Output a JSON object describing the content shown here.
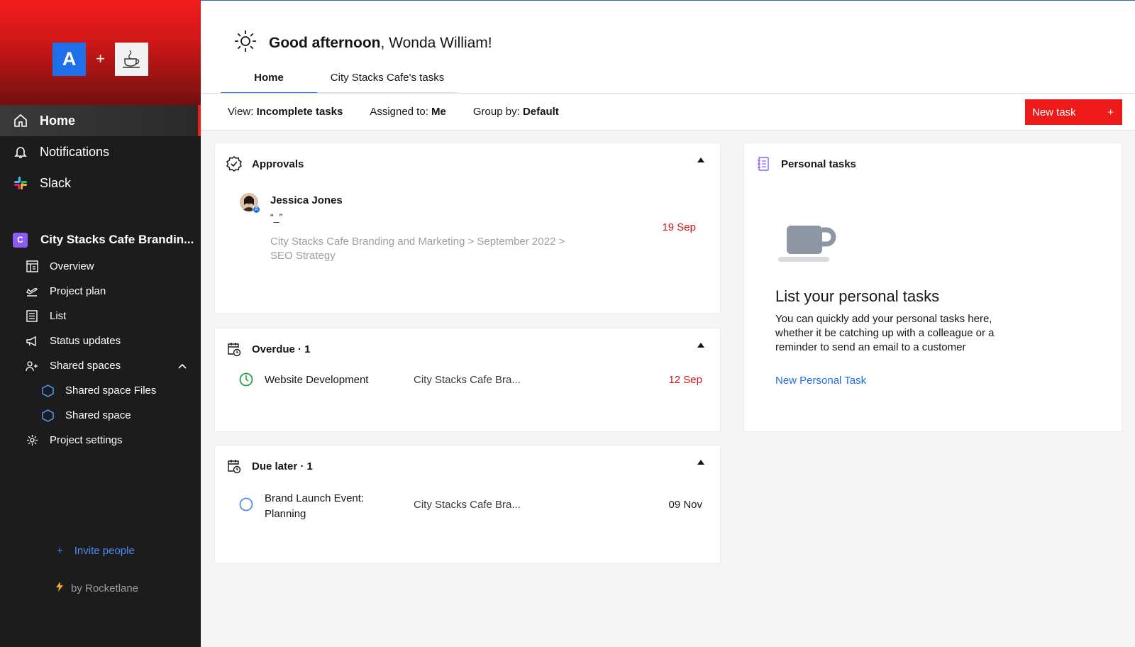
{
  "sidebar": {
    "brand_plus": "+",
    "brand_logo_letter": "A",
    "nav": [
      {
        "label": "Home",
        "icon": "home-icon"
      },
      {
        "label": "Notifications",
        "icon": "bell-icon"
      },
      {
        "label": "Slack",
        "icon": "slack-icon"
      }
    ],
    "project": {
      "badge": "C",
      "title": "City Stacks Cafe Brandin...",
      "items": [
        {
          "label": "Overview",
          "icon": "overview-icon"
        },
        {
          "label": "Project plan",
          "icon": "plane-icon"
        },
        {
          "label": "List",
          "icon": "list-icon"
        },
        {
          "label": "Status updates",
          "icon": "megaphone-icon"
        },
        {
          "label": "Shared spaces",
          "icon": "users-icon"
        },
        {
          "label": "Shared space Files",
          "icon": "hexagon-icon"
        },
        {
          "label": "Shared space",
          "icon": "hexagon-icon"
        },
        {
          "label": "Project settings",
          "icon": "gear-icon"
        }
      ]
    },
    "invite": {
      "plus": "+",
      "label": "Invite people"
    },
    "byline": "by Rocketlane"
  },
  "header": {
    "greeting_bold": "Good afternoon",
    "greeting_rest": ", Wonda William!",
    "tabs": [
      {
        "label": "Home"
      },
      {
        "label": "City Stacks Cafe's tasks"
      }
    ]
  },
  "filters": {
    "view_label": "View:",
    "view_value": "Incomplete tasks",
    "assigned_label": "Assigned to:",
    "assigned_value": "Me",
    "group_label": "Group by:",
    "group_value": "Default",
    "new_task": "New task",
    "new_task_plus": "+"
  },
  "approvals": {
    "title": "Approvals",
    "item": {
      "name": "Jessica Jones",
      "quote": "“_”",
      "path_line1": "City Stacks Cafe Branding and Marketing > September 2022 >",
      "path_line2": "SEO Strategy",
      "date": "19 Sep",
      "avatar_badge": "A"
    }
  },
  "overdue": {
    "title": "Overdue · 1",
    "item": {
      "name": "Website Development",
      "project": "City Stacks Cafe Bra...",
      "date": "12 Sep"
    }
  },
  "due_later": {
    "title": "Due later · 1",
    "item": {
      "name_line1": "Brand Launch Event:",
      "name_line2": "Planning",
      "project": "City Stacks Cafe Bra...",
      "date": "09 Nov"
    }
  },
  "personal": {
    "title": "Personal tasks",
    "heading": "List your personal tasks",
    "desc_line1": "You can quickly add your personal tasks here,",
    "desc_line2": "whether it be catching up with a colleague or a",
    "desc_line3": "reminder to send an email to a customer",
    "link": "New Personal Task"
  }
}
